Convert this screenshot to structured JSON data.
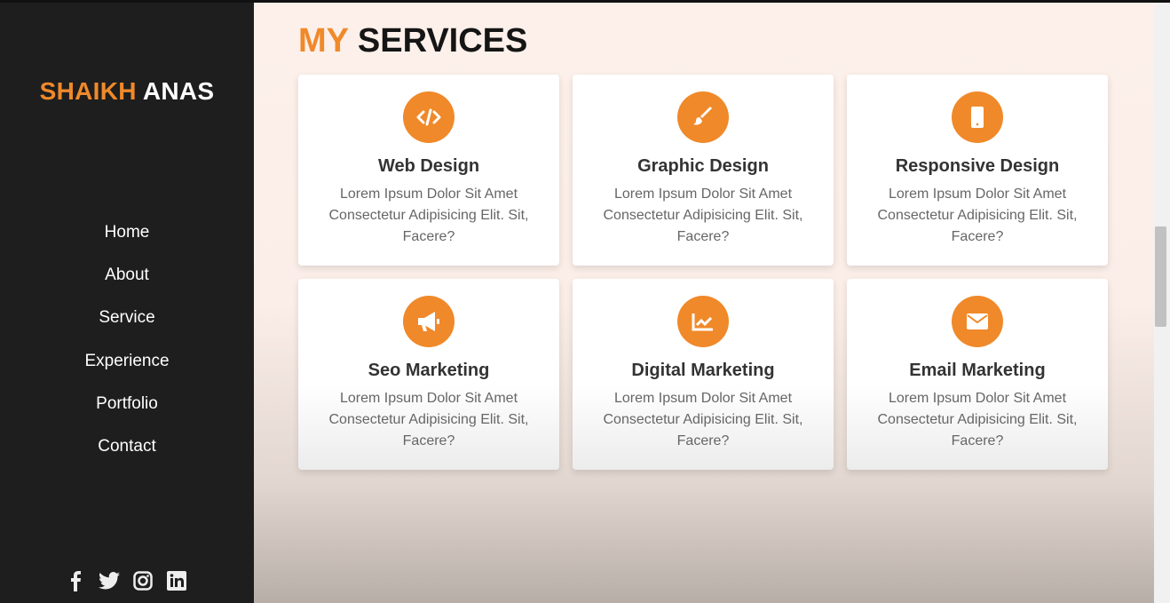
{
  "brand": {
    "first": "SHAIKH",
    "last": "ANAS"
  },
  "nav": [
    "Home",
    "About",
    "Service",
    "Experience",
    "Portfolio",
    "Contact"
  ],
  "social": [
    "facebook-icon",
    "twitter-icon",
    "instagram-icon",
    "linkedin-icon"
  ],
  "section": {
    "title_accent": "MY",
    "title_rest": "SERVICES"
  },
  "accent": "#f0892a",
  "services": [
    {
      "icon": "code-icon",
      "title": "Web Design",
      "text": "Lorem Ipsum Dolor Sit Amet Consectetur Adipisicing Elit. Sit, Facere?"
    },
    {
      "icon": "brush-icon",
      "title": "Graphic Design",
      "text": "Lorem Ipsum Dolor Sit Amet Consectetur Adipisicing Elit. Sit, Facere?"
    },
    {
      "icon": "mobile-icon",
      "title": "Responsive Design",
      "text": "Lorem Ipsum Dolor Sit Amet Consectetur Adipisicing Elit. Sit, Facere?"
    },
    {
      "icon": "megaphone-icon",
      "title": "Seo Marketing",
      "text": "Lorem Ipsum Dolor Sit Amet Consectetur Adipisicing Elit. Sit, Facere?"
    },
    {
      "icon": "chart-icon",
      "title": "Digital Marketing",
      "text": "Lorem Ipsum Dolor Sit Amet Consectetur Adipisicing Elit. Sit, Facere?"
    },
    {
      "icon": "envelope-icon",
      "title": "Email Marketing",
      "text": "Lorem Ipsum Dolor Sit Amet Consectetur Adipisicing Elit. Sit, Facere?"
    }
  ]
}
